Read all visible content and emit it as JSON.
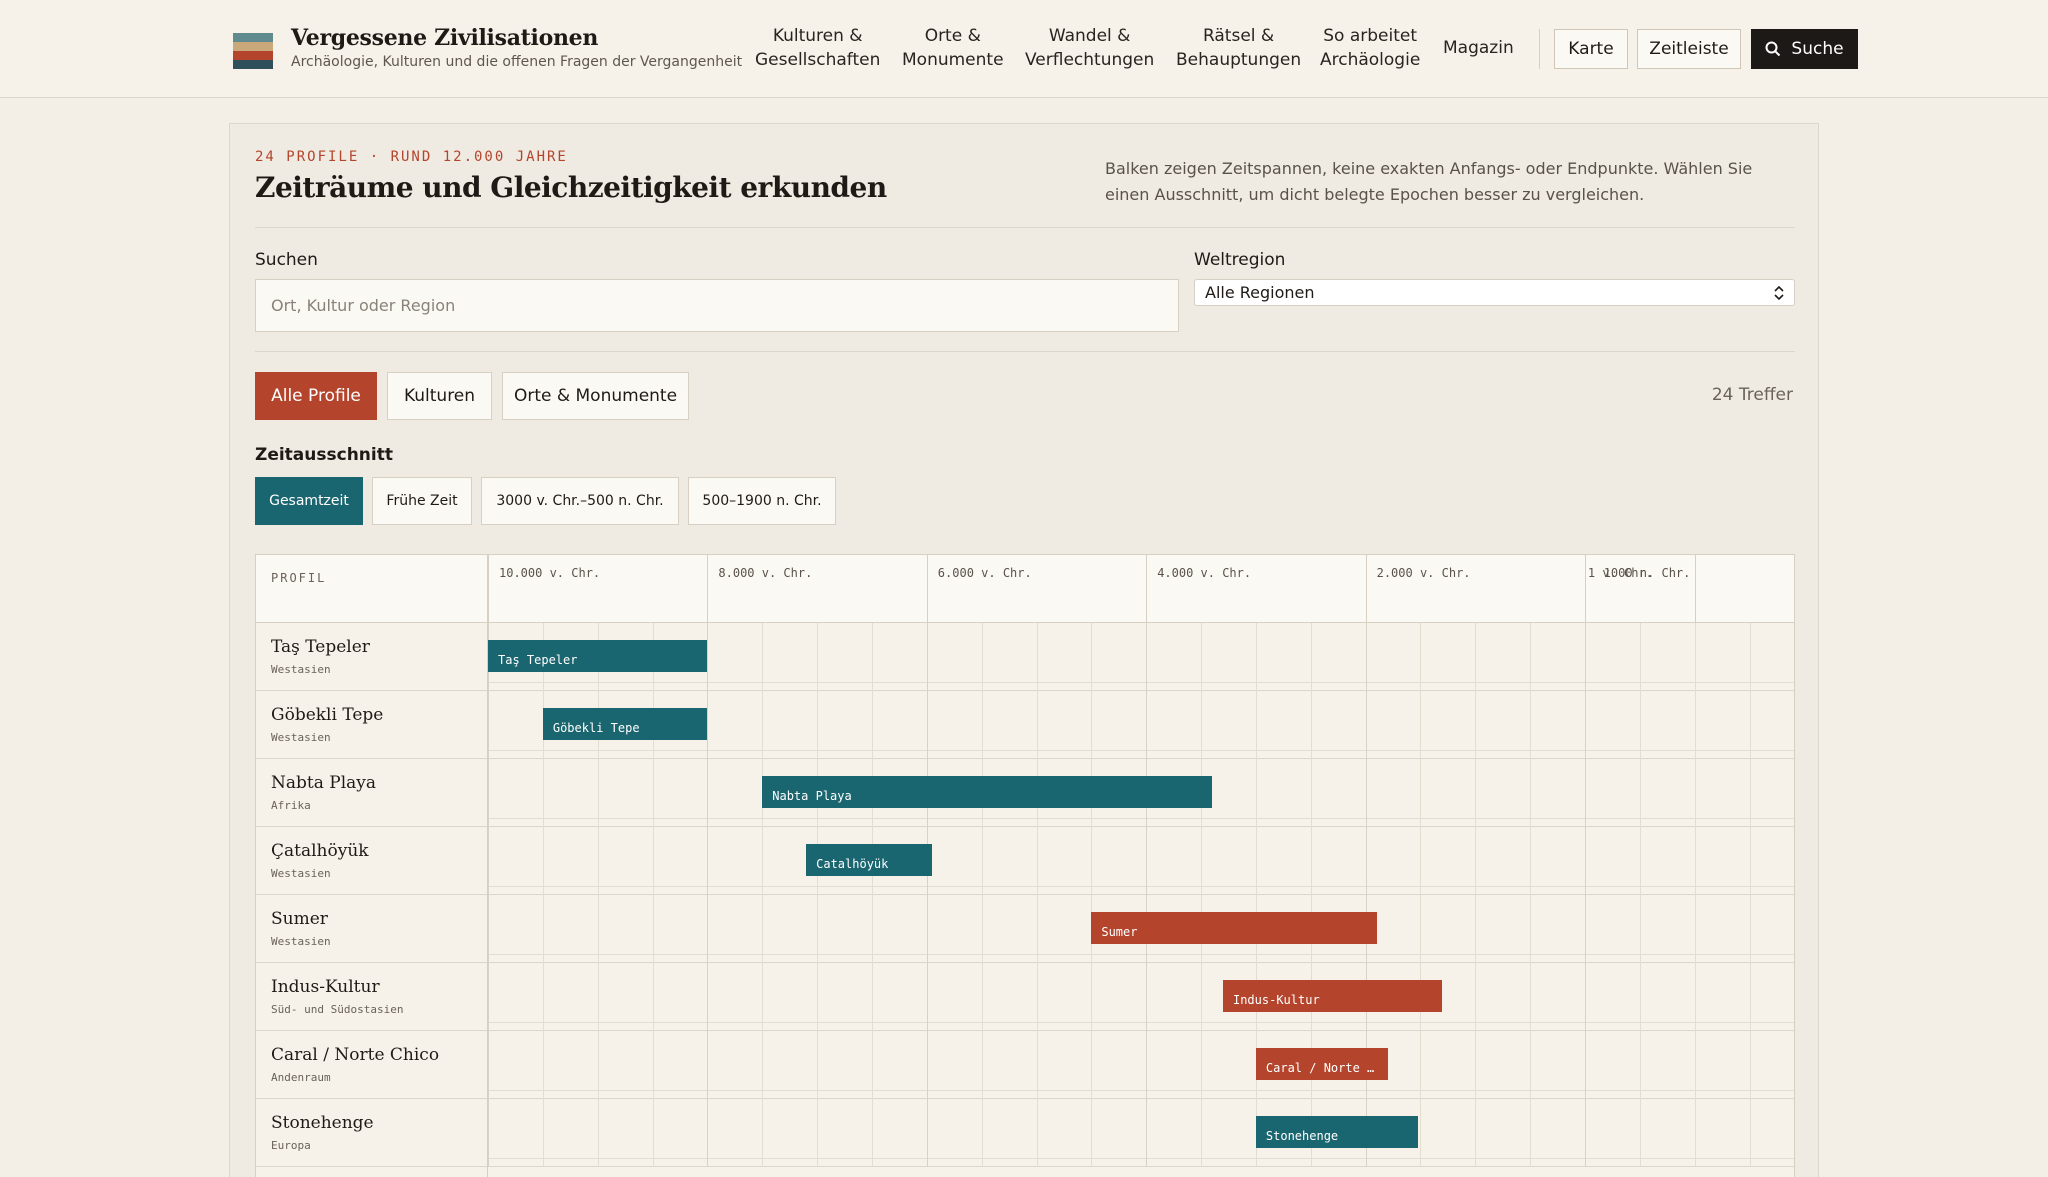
{
  "header": {
    "brand_title": "Vergessene Zivilisationen",
    "brand_subtitle": "Archäologie, Kulturen und die offenen Fragen der Vergangenheit",
    "nav": [
      {
        "line1": "Kulturen &",
        "line2": "Gesellschaften"
      },
      {
        "line1": "Orte &",
        "line2": "Monumente"
      },
      {
        "line1": "Wandel &",
        "line2": "Verflechtungen"
      },
      {
        "line1": "Rätsel &",
        "line2": "Behauptungen"
      },
      {
        "line1": "So arbeitet",
        "line2": "Archäologie"
      },
      {
        "line1": "Magazin",
        "line2": ""
      }
    ],
    "buttons": {
      "map": "Karte",
      "timeline": "Zeitleiste",
      "search": "Suche"
    },
    "logo_colors": [
      "#2f4f5a",
      "#c9a97c",
      "#b4452c",
      "#5f8a8e"
    ]
  },
  "panel": {
    "eyebrow": "24 PROFILE · RUND 12.000 JAHRE",
    "title": "Zeiträume und Gleichzeitigkeit erkunden",
    "description": "Balken zeigen Zeitspannen, keine exakten Anfangs- oder Endpunkte. Wählen Sie einen Ausschnitt, um dicht belegte Epochen besser zu vergleichen.",
    "search": {
      "label": "Suchen",
      "placeholder": "Ort, Kultur oder Region"
    },
    "region": {
      "label": "Weltregion",
      "selected": "Alle Regionen"
    },
    "filters": [
      "Alle Profile",
      "Kulturen",
      "Orte & Monumente"
    ],
    "active_filter": "Alle Profile",
    "result_count": "24 Treffer",
    "zeitausschnitt": {
      "label": "Zeitausschnitt",
      "options": [
        "Gesamtzeit",
        "Frühe Zeit",
        "3000 v. Chr.–500 n. Chr.",
        "500–1900 n. Chr."
      ],
      "active": "Gesamtzeit"
    }
  },
  "timeline": {
    "column_header": "PROFIL",
    "ticks": [
      "10.000 v. Chr.",
      "8.000 v. Chr.",
      "6.000 v. Chr.",
      "4.000 v. Chr.",
      "2.000 v. Chr.",
      "1 v. Chr.",
      "1000 n. Chr."
    ],
    "rows": [
      {
        "name": "Taş Tepeler",
        "region": "Westasien",
        "bar_label": "Taş Tepeler",
        "start": -10000,
        "end": -8000,
        "color": "teal"
      },
      {
        "name": "Göbekli Tepe",
        "region": "Westasien",
        "bar_label": "Göbekli Tepe",
        "start": -9500,
        "end": -8000,
        "color": "teal"
      },
      {
        "name": "Nabta Playa",
        "region": "Afrika",
        "bar_label": "Nabta Playa",
        "start": -7500,
        "end": -3400,
        "color": "teal"
      },
      {
        "name": "Çatalhöyük",
        "region": "Westasien",
        "bar_label": "Catalhöyük",
        "start": -7100,
        "end": -5950,
        "color": "teal"
      },
      {
        "name": "Sumer",
        "region": "Westasien",
        "bar_label": "Sumer",
        "start": -4500,
        "end": -1900,
        "color": "red"
      },
      {
        "name": "Indus-Kultur",
        "region": "Süd- und Südostasien",
        "bar_label": "Indus-Kultur",
        "start": -3300,
        "end": -1300,
        "color": "red"
      },
      {
        "name": "Caral / Norte Chico",
        "region": "Andenraum",
        "bar_label": "Caral / Norte …",
        "start": -3000,
        "end": -1800,
        "color": "red"
      },
      {
        "name": "Stonehenge",
        "region": "Europa",
        "bar_label": "Stonehenge",
        "start": -3000,
        "end": -1520,
        "color": "teal"
      }
    ]
  },
  "colors": {
    "teal": "#1a6670",
    "red": "#b4452c",
    "dark": "#1c1916"
  }
}
